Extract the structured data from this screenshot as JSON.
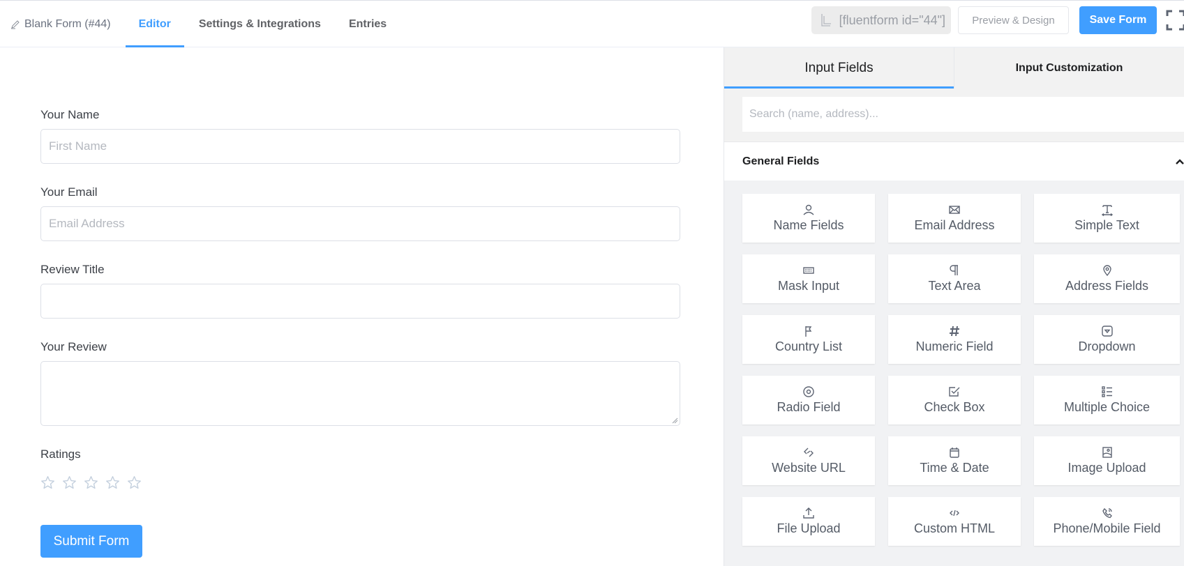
{
  "header": {
    "form_title": "Blank Form (#44)",
    "tabs": [
      {
        "label": "Editor",
        "active": true
      },
      {
        "label": "Settings & Integrations",
        "active": false
      },
      {
        "label": "Entries",
        "active": false
      }
    ],
    "shortcode": "[fluentform id=\"44\"]",
    "preview_label": "Preview & Design",
    "save_label": "Save Form"
  },
  "form": {
    "fields": [
      {
        "label": "Your Name",
        "placeholder": "First Name",
        "type": "input"
      },
      {
        "label": "Your Email",
        "placeholder": "Email Address",
        "type": "input"
      },
      {
        "label": "Review Title",
        "placeholder": "",
        "type": "input"
      },
      {
        "label": "Your Review",
        "placeholder": "",
        "type": "textarea"
      }
    ],
    "ratings": {
      "label": "Ratings",
      "max": 5,
      "value": 0
    },
    "submit_label": "Submit Form"
  },
  "sidebar": {
    "tabs": [
      {
        "label": "Input Fields",
        "active": true
      },
      {
        "label": "Input Customization",
        "active": false
      }
    ],
    "search_placeholder": "Search (name, address)...",
    "group_title": "General Fields",
    "items": [
      {
        "label": "Name Fields",
        "icon": "user-icon"
      },
      {
        "label": "Email Address",
        "icon": "envelope-icon"
      },
      {
        "label": "Simple Text",
        "icon": "text-icon"
      },
      {
        "label": "Mask Input",
        "icon": "keyboard-icon"
      },
      {
        "label": "Text Area",
        "icon": "paragraph-icon"
      },
      {
        "label": "Address Fields",
        "icon": "location-pin-icon"
      },
      {
        "label": "Country List",
        "icon": "flag-icon"
      },
      {
        "label": "Numeric Field",
        "icon": "hash-icon"
      },
      {
        "label": "Dropdown",
        "icon": "dropdown-icon"
      },
      {
        "label": "Radio Field",
        "icon": "radio-icon"
      },
      {
        "label": "Check Box",
        "icon": "checkbox-icon"
      },
      {
        "label": "Multiple Choice",
        "icon": "list-icon"
      },
      {
        "label": "Website URL",
        "icon": "link-icon"
      },
      {
        "label": "Time & Date",
        "icon": "calendar-icon"
      },
      {
        "label": "Image Upload",
        "icon": "image-icon"
      },
      {
        "label": "File Upload",
        "icon": "upload-icon"
      },
      {
        "label": "Custom HTML",
        "icon": "code-icon"
      },
      {
        "label": "Phone/Mobile Field",
        "icon": "phone-icon"
      }
    ]
  }
}
